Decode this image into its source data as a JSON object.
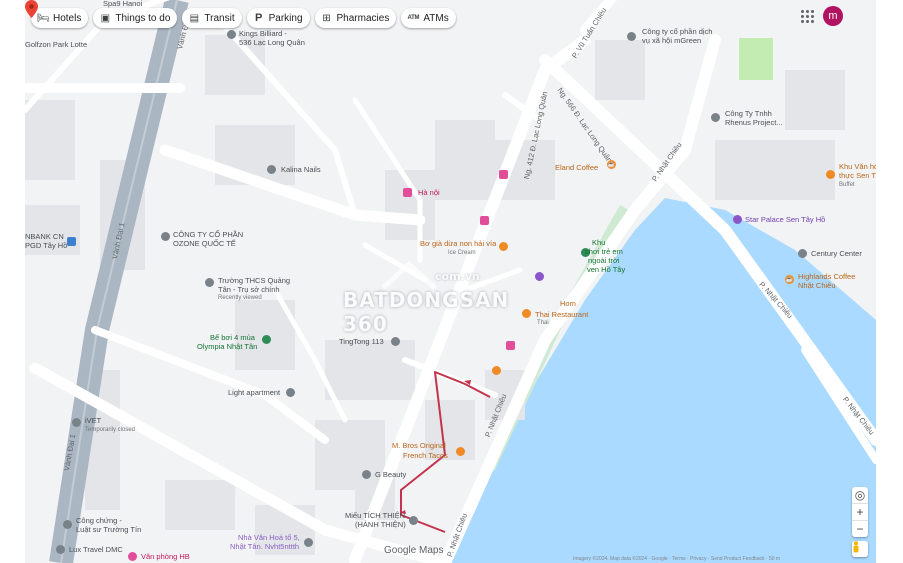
{
  "toolbar": {
    "chips": [
      {
        "label": "Hotels",
        "icon": "bed-icon"
      },
      {
        "label": "Things to do",
        "icon": "camera-icon"
      },
      {
        "label": "Transit",
        "icon": "bus-icon"
      },
      {
        "label": "Parking",
        "icon": "parking-icon"
      },
      {
        "label": "Pharmacies",
        "icon": "pharmacy-icon"
      },
      {
        "label": "ATMs",
        "icon": "atm-icon"
      }
    ],
    "avatar_letter": "m"
  },
  "map": {
    "colors": {
      "water": "#aadaff",
      "park": "#c3ecb2",
      "road": "#ffffff",
      "highway": "#aab6c2",
      "route": "#c2334d",
      "pin": "#ea4335"
    },
    "streets": {
      "vanh_dai_1_top": "Vành Đai 1",
      "vanh_dai_1_mid": "Vành Đai 1",
      "vanh_dai_1_low": "Vành Đai 1",
      "vu_tuan_chieu": "P. Vũ Tuấn Chiêu",
      "lac_long_quan_566": "Ng. 566 Đ. Lạc Long Quân",
      "lac_long_quan_412": "Ng. 412 Đ. Lạc Long Quân",
      "nhat_chieu_1": "P. Nhật Chiêu",
      "nhat_chieu_2": "P. Nhật Chiêu",
      "nhat_chieu_3": "P. Nhật Chiêu",
      "nhat_chieu_4": "P. Nhật Chiêu",
      "nhat_chieu_5": "P. Nhật Chiêu"
    },
    "places": {
      "spa9": "Spa9 Hanoi",
      "golfzon": "Golfzon Park Lotte",
      "kings_billiard_1": "Kings Billiard -",
      "kings_billiard_2": "536 Lạc Long Quân",
      "mgreen_1": "Công ty cổ phần dịch",
      "mgreen_2": "vụ xã hội mGreen",
      "rhenus_1": "Công Ty Tnhh",
      "rhenus_2": "Rhenus Project...",
      "kalina": "Kalina Nails",
      "eland": "Eland Coffee",
      "khu_van_hoa_1": "Khu Văn hó",
      "khu_van_hoa_2": "thực Sen T",
      "khu_van_hoa_3": "Buffet",
      "ha_noi": "Hà nội",
      "bank_1": "NBANK CN",
      "bank_2": "PGD Tây Hồ",
      "ozone_1": "CÔNG TY CỔ PHẦN",
      "ozone_2": "OZONE QUỐC TẾ",
      "star_palace": "Star Palace Sen Tây Hồ",
      "bo_gia_1": "Bơ già dừa non hải vía",
      "bo_gia_2": "Ice Cream",
      "khu_vui_1": "Khu",
      "khu_vui_2": "chơi trẻ em",
      "khu_vui_3": "ngoài trời",
      "khu_vui_4": "ven Hồ Tây",
      "century": "Century Center",
      "highlands_1": "Highlands Coffee",
      "highlands_2": "Nhật Chiêu",
      "truong_1": "Trường THCS Quảng",
      "truong_2": "Tân - Trụ sở chính",
      "truong_3": "Recently viewed",
      "hom_1": "Hom",
      "hom_2": "Thai Restaurant",
      "hom_3": "Thai",
      "be_boi_1": "Bể bơi 4 mùa",
      "be_boi_2": "Olympia Nhật Tân",
      "tingtong": "TingTong 113",
      "light_apartment": "Light apartment",
      "ivet_1": "iVET",
      "ivet_2": "Temporarily closed",
      "mbros_1": "M. Bros Original",
      "mbros_2": "French Tacos",
      "g_beauty": "G Beauty",
      "mieu_1": "Miếu TÍCH THIỆN",
      "mieu_2": "(HÀNH THIỆN)",
      "cong_chung_1": "Công chứng -",
      "cong_chung_2": "Luật sư Trường Tín",
      "nha_van_hoa_1": "Nhà Văn Hoá tổ 5,",
      "nha_van_hoa_2": "Nhật Tân. Nvht5nttth",
      "lux_travel": "Lux Travel DMC",
      "van_phong": "Văn phòng HB"
    },
    "watermark": {
      "url": "com.vn",
      "brand": "BATDONGSAN 360"
    },
    "logo": "Google Maps",
    "footer": "Imagery ©2024, Map data ©2024 · Google · Terms · Privacy · Send Product Feedback · 50 m"
  }
}
